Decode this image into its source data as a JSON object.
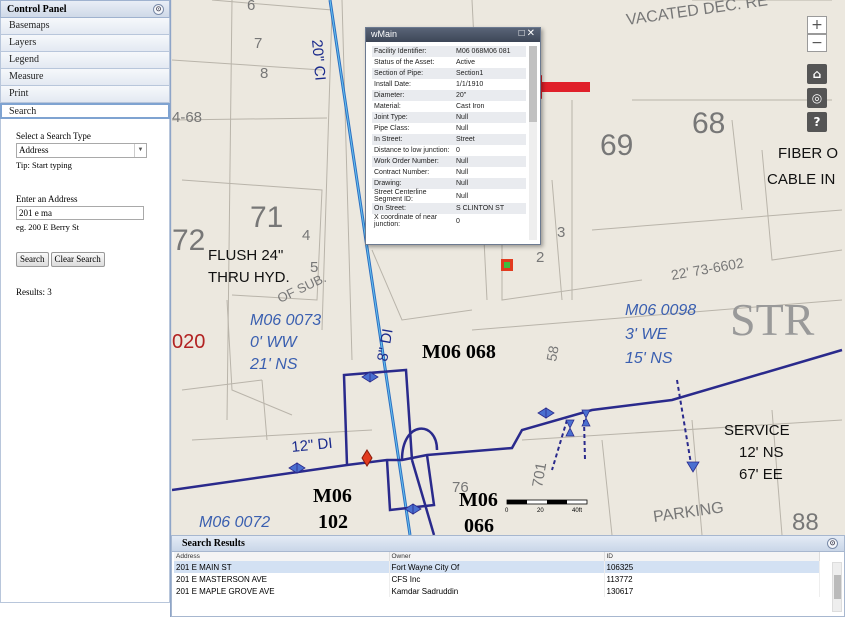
{
  "control_panel": {
    "title": "Control Panel",
    "sections": [
      "Basemaps",
      "Layers",
      "Legend",
      "Measure",
      "Print",
      "Search"
    ],
    "search": {
      "type_label": "Select a Search Type",
      "type_value": "Address",
      "tip": "Tip: Start typing",
      "address_label": "Enter an Address",
      "address_value": "201 e ma",
      "address_example": "eg. 200 E Berry St",
      "search_button": "Search",
      "clear_button": "Clear Search",
      "results_text": "Results: 3"
    }
  },
  "map": {
    "labels": {
      "street_20ci": "20\" CI",
      "vacated": "VACATED DEC. RE",
      "fiber": "FIBER O",
      "cable": "CABLE IN",
      "flush1": "FLUSH 24\"",
      "flush2": "THRU HYD.",
      "dim_2273": "22' 73-6602",
      "strip": "STR",
      "m06_0073_a": "M06 0073",
      "m06_0073_b": "0' WW",
      "m06_0073_c": "21' NS",
      "m06_0098_a": "M06 0098",
      "m06_0098_b": "3' WE",
      "m06_0098_c": "15' NS",
      "m06_068": "M06 068",
      "di_8": "8\" DI",
      "di_12": "12\" DI",
      "service_a": "SERVICE",
      "service_b": "12' NS",
      "service_c": "67' EE",
      "m06_102_a": "M06",
      "m06_102_b": "102",
      "m06_066_a": "M06",
      "m06_066_b": "066",
      "m06_0072": "M06 0072",
      "parking": "PARKING",
      "of_sub": "OF SUB.",
      "code_020": "020",
      "lot_68": "68",
      "lot_69": "69",
      "lot_71": "71",
      "lot_72": "72",
      "lot_7": "7",
      "lot_8": "8",
      "lot_6": "6",
      "lot_5": "5",
      "lot_4": "4",
      "lot_3": "3",
      "lot_2": "2",
      "lot_76": "76",
      "lot_701": "701",
      "lot_88": "88",
      "lot_58": "58",
      "lot_neg68": "4-68",
      "scale_0": "0",
      "scale_20": "20",
      "scale_40": "40ft"
    },
    "zoom_in": "+",
    "zoom_out": "−",
    "tools": [
      "home-icon",
      "locate-icon",
      "help-icon"
    ]
  },
  "popup": {
    "title": "wMain",
    "controls": "□ ✕",
    "attributes": [
      {
        "key": "Facility Identifier:",
        "value": "M06 068M06 081"
      },
      {
        "key": "Status of the Asset:",
        "value": "Active"
      },
      {
        "key": "Section of Pipe:",
        "value": "Section1"
      },
      {
        "key": "Install Date:",
        "value": "1/1/1910"
      },
      {
        "key": "Diameter:",
        "value": "20\""
      },
      {
        "key": "Material:",
        "value": "Cast Iron"
      },
      {
        "key": "Joint Type:",
        "value": "Null"
      },
      {
        "key": "Pipe Class:",
        "value": "Null"
      },
      {
        "key": "In Street:",
        "value": "Street"
      },
      {
        "key": "Distance to low junction:",
        "value": "0"
      },
      {
        "key": "Work Order Number:",
        "value": "Null"
      },
      {
        "key": "Contract Number:",
        "value": "Null"
      },
      {
        "key": "Drawing:",
        "value": "Null"
      },
      {
        "key": "Street Centerline Segment ID:",
        "value": "Null"
      },
      {
        "key": "On Street:",
        "value": "S CLINTON ST"
      },
      {
        "key": "X coordinate of near junction:",
        "value": "0"
      }
    ]
  },
  "results": {
    "title": "Search Results",
    "columns": [
      "Address",
      "Owner",
      "ID"
    ],
    "rows": [
      {
        "address": "201 E MAIN ST",
        "owner": "Fort Wayne City Of",
        "id": "106325"
      },
      {
        "address": "201 E MASTERSON AVE",
        "owner": "CFS Inc",
        "id": "113772"
      },
      {
        "address": "201 E MAPLE GROVE AVE",
        "owner": "Kamdar Sadruddin",
        "id": "130617"
      }
    ]
  },
  "colors": {
    "water_main": "#2a2a8c",
    "arrow": "#e0202a",
    "annotation": "#3a5fb0"
  }
}
